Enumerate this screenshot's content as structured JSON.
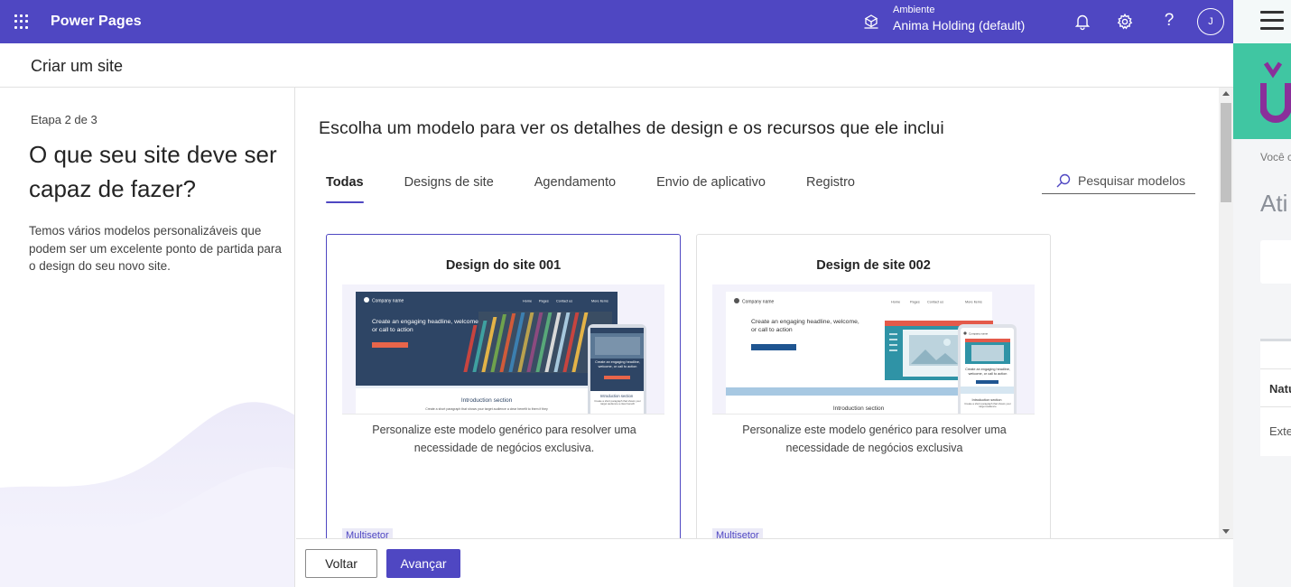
{
  "topbar": {
    "app_title": "Power Pages",
    "env_label": "Ambiente",
    "env_value": "Anima Holding (default)",
    "avatar_initial": "J",
    "help_glyph": "?",
    "icons": [
      "waffle-icon",
      "environment-icon",
      "bell-icon",
      "gear-icon",
      "help-icon"
    ]
  },
  "page": {
    "title": "Criar um site"
  },
  "left": {
    "step": "Etapa 2 de 3",
    "heading": "O que seu site deve ser capaz de fazer?",
    "description": "Temos vários modelos personalizáveis que podem ser um excelente ponto de partida para o design do seu novo site."
  },
  "main": {
    "heading": "Escolha um modelo para ver os detalhes de design e os recursos que ele inclui",
    "tabs": [
      {
        "label": "Todas",
        "active": true
      },
      {
        "label": "Designs de site",
        "active": false
      },
      {
        "label": "Agendamento",
        "active": false
      },
      {
        "label": "Envio de aplicativo",
        "active": false
      },
      {
        "label": "Registro",
        "active": false
      }
    ],
    "search_placeholder": "Pesquisar modelos",
    "cards": [
      {
        "title": "Design do site 001",
        "description": "Personalize este modelo genérico para resolver uma necessidade de negócios exclusiva.",
        "badge": "Multisetor",
        "selected": true,
        "thumb": {
          "company": "Company name",
          "nav": [
            "Home",
            "Pages",
            "Contact us",
            "More items"
          ],
          "headline": "Create an engaging headline, welcome, or call to action",
          "button": "Add a call to action here",
          "intro_title": "Introduction section",
          "intro_text": "Create a short paragraph that shows your target audience a clear benefit to them if they",
          "mobile_headline": "Create an engaging headline, welcome, or call to action",
          "mobile_intro": "Introduction section",
          "mobile_text": "Create a short paragraph that shows your target audience a clear benefit"
        }
      },
      {
        "title": "Design de site 002",
        "description": "Personalize este modelo genérico para resolver uma necessidade de negócios exclusiva",
        "badge": "Multisetor",
        "selected": false,
        "thumb": {
          "company": "Company name",
          "nav": [
            "Home",
            "Pages",
            "Contact us",
            "More items"
          ],
          "headline": "Create an engaging headline, welcome, or call to action",
          "button": "Add a call to action here",
          "intro_title": "Introduction section",
          "mobile_company": "Company name",
          "mobile_headline": "Create an engaging headline, welcome, or call to action",
          "mobile_intro": "Introduction section",
          "mobile_text": "Create a short paragraph that shows your target audience"
        }
      }
    ]
  },
  "footer": {
    "back_label": "Voltar",
    "next_label": "Avançar"
  },
  "side_app": {
    "text_voce": "Você c",
    "text_ati": "Ati",
    "text_natu": "Natu",
    "text_exte": "Exte"
  },
  "colors": {
    "brand": "#4f47c2",
    "thumb1_hero": "#2e4565",
    "thumb_cta": "#e8654a",
    "thumb2_cta": "#1f5591",
    "thumb2_accent": "#e45a4a",
    "thumb2_teal": "#2f93a6",
    "side_green": "#40c6a2",
    "side_purple": "#8a2f9a"
  }
}
